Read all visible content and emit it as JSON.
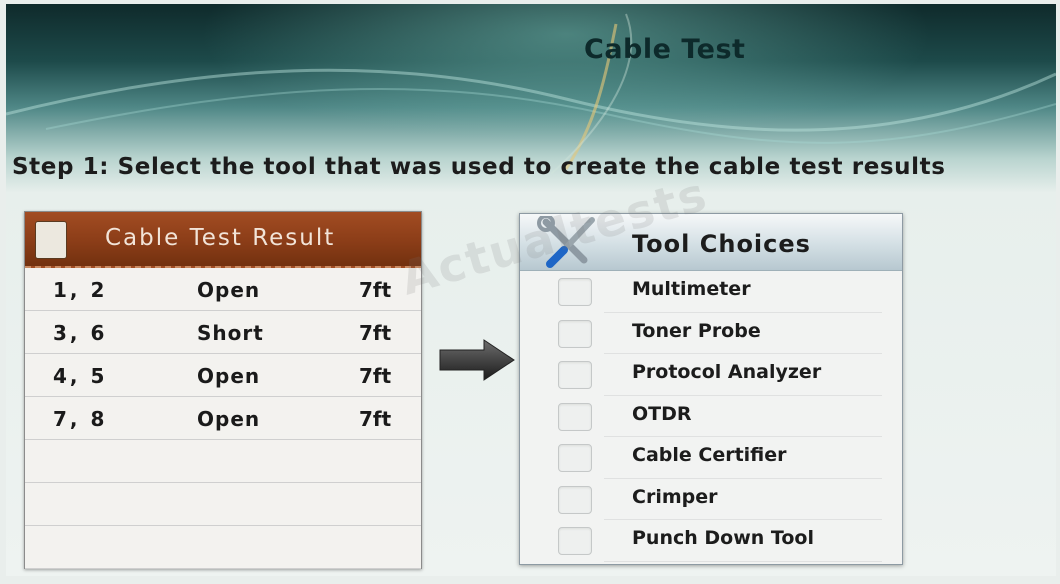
{
  "title": "Cable Test",
  "instruction": "Step 1: Select the tool that was used to create the cable test results",
  "watermark": "Actualtests",
  "result_panel": {
    "title": "Cable Test Result",
    "rows": [
      {
        "pins": "1, 2",
        "state": "Open",
        "length": "7ft"
      },
      {
        "pins": "3, 6",
        "state": "Short",
        "length": "7ft"
      },
      {
        "pins": "4, 5",
        "state": "Open",
        "length": "7ft"
      },
      {
        "pins": "7, 8",
        "state": "Open",
        "length": "7ft"
      },
      {
        "pins": "",
        "state": "",
        "length": ""
      },
      {
        "pins": "",
        "state": "",
        "length": ""
      },
      {
        "pins": "",
        "state": "",
        "length": ""
      }
    ]
  },
  "tool_panel": {
    "title": "Tool Choices",
    "icon": "tools-icon",
    "options": [
      {
        "label": "Multimeter",
        "checked": false
      },
      {
        "label": "Toner Probe",
        "checked": false
      },
      {
        "label": "Protocol Analyzer",
        "checked": false
      },
      {
        "label": "OTDR",
        "checked": false
      },
      {
        "label": "Cable Certifier",
        "checked": false
      },
      {
        "label": "Crimper",
        "checked": false
      },
      {
        "label": "Punch Down Tool",
        "checked": false
      }
    ]
  },
  "colors": {
    "result_header": "#8b3d18",
    "tool_header": "#cfdde3",
    "background_dark": "#0f2a2b"
  }
}
